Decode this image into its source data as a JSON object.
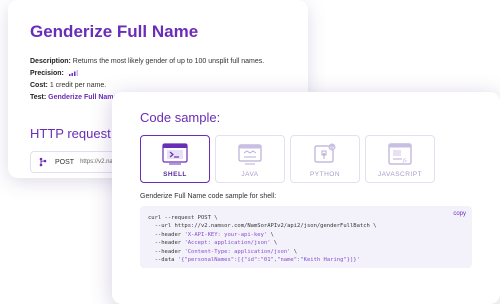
{
  "background_card": {
    "title": "Genderize Full Name",
    "description_label": "Description:",
    "description_text": " Returns the most likely gender of up to 100 unsplit full names.",
    "precision_label": "Precision:",
    "cost_label": "Cost:",
    "cost_text": " 1 credit per name.",
    "test_label": "Test:",
    "test_link": "Genderize Full Name l",
    "http_heading": "HTTP request",
    "method": "POST",
    "url_prefix": "https://v2.nam"
  },
  "code_sample": {
    "title": "Code sample:",
    "tabs": [
      {
        "label": "SHELL",
        "icon": "terminal-icon",
        "active": true
      },
      {
        "label": "JAVA",
        "icon": "java-icon",
        "active": false
      },
      {
        "label": "PYTHON",
        "icon": "python-icon",
        "active": false
      },
      {
        "label": "JAVASCRIPT",
        "icon": "javascript-icon",
        "active": false
      }
    ],
    "caption": "Genderize Full Name code sample for shell:",
    "copy_label": "copy",
    "lines": {
      "l1": "curl --request POST \\",
      "l2": "  --url https://v2.namsor.com/NamSorAPIv2/api2/json/genderFullBatch \\",
      "l3_prefix": "  --header ",
      "l3_str": "'X-API-KEY: your-api-key'",
      "l3_suffix": " \\",
      "l4_prefix": "  --header ",
      "l4_str": "'Accept: application/json'",
      "l4_suffix": " \\",
      "l5_prefix": "  --header ",
      "l5_str": "'Content-Type: application/json'",
      "l5_suffix": " \\",
      "l6_prefix": "  --data ",
      "l6_str": "'{\"personalNames\":[{\"id\":\"01\",\"name\":\"Keith Haring\"}]}'"
    }
  },
  "colors": {
    "accent": "#6a2db8",
    "code_bg": "#f3f2fa",
    "tab_inactive": "#a79bc8"
  }
}
